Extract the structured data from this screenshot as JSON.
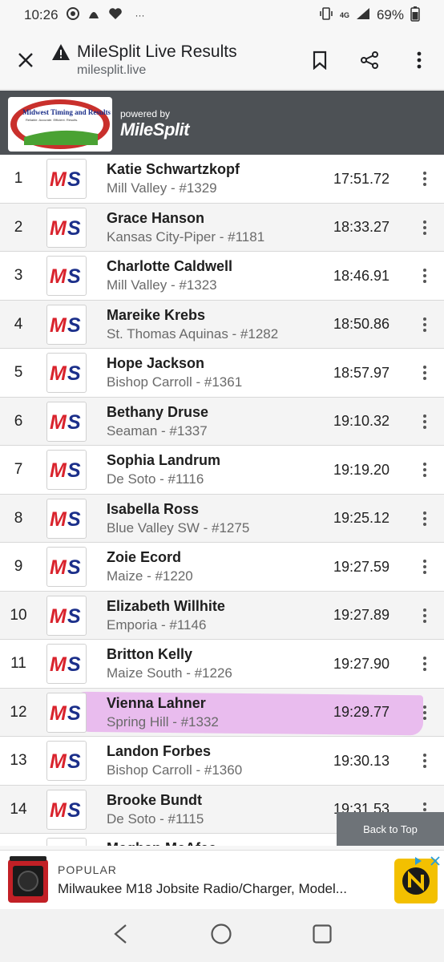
{
  "status_bar": {
    "time": "10:26",
    "battery": "69%",
    "network": "4G"
  },
  "toolbar": {
    "title": "MileSplit Live Results",
    "url": "milesplit.live"
  },
  "header": {
    "logo_text": "Midwest Timing and Results",
    "logo_tagline": "Reliable. Accurate. Efficient. Results.",
    "powered_by": "powered by",
    "brand": "MileSplit"
  },
  "logo_mark": "MS",
  "results": [
    {
      "place": "1",
      "name": "Katie Schwartzkopf",
      "team": "Mill Valley - #1329",
      "time": "17:51.72"
    },
    {
      "place": "2",
      "name": "Grace Hanson",
      "team": "Kansas City-Piper - #1181",
      "time": "18:33.27"
    },
    {
      "place": "3",
      "name": "Charlotte Caldwell",
      "team": "Mill Valley - #1323",
      "time": "18:46.91"
    },
    {
      "place": "4",
      "name": "Mareike Krebs",
      "team": "St. Thomas Aquinas - #1282",
      "time": "18:50.86"
    },
    {
      "place": "5",
      "name": "Hope Jackson",
      "team": "Bishop Carroll - #1361",
      "time": "18:57.97"
    },
    {
      "place": "6",
      "name": "Bethany Druse",
      "team": "Seaman - #1337",
      "time": "19:10.32"
    },
    {
      "place": "7",
      "name": "Sophia Landrum",
      "team": "De Soto - #1116",
      "time": "19:19.20"
    },
    {
      "place": "8",
      "name": "Isabella Ross",
      "team": "Blue Valley SW - #1275",
      "time": "19:25.12"
    },
    {
      "place": "9",
      "name": "Zoie Ecord",
      "team": "Maize - #1220",
      "time": "19:27.59"
    },
    {
      "place": "10",
      "name": "Elizabeth Willhite",
      "team": "Emporia - #1146",
      "time": "19:27.89"
    },
    {
      "place": "11",
      "name": "Britton Kelly",
      "team": "Maize South - #1226",
      "time": "19:27.90"
    },
    {
      "place": "12",
      "name": "Vienna Lahner",
      "team": "Spring Hill - #1332",
      "time": "19:29.77",
      "highlighted": true
    },
    {
      "place": "13",
      "name": "Landon Forbes",
      "team": "Bishop Carroll - #1360",
      "time": "19:30.13"
    },
    {
      "place": "14",
      "name": "Brooke Bundt",
      "team": "De Soto - #1115",
      "time": "19:31.53"
    },
    {
      "place": "",
      "name": "Meghan McAfee",
      "team": "",
      "time": ""
    }
  ],
  "back_to_top": "Back to Top",
  "ad": {
    "tag": "POPULAR",
    "text": "Milwaukee M18 Jobsite Radio/Charger, Model..."
  },
  "colors": {
    "header_bg": "#4d5155",
    "ms_red": "#d9232d",
    "ms_blue": "#1b2f8a",
    "highlight": "#dc78e6"
  }
}
